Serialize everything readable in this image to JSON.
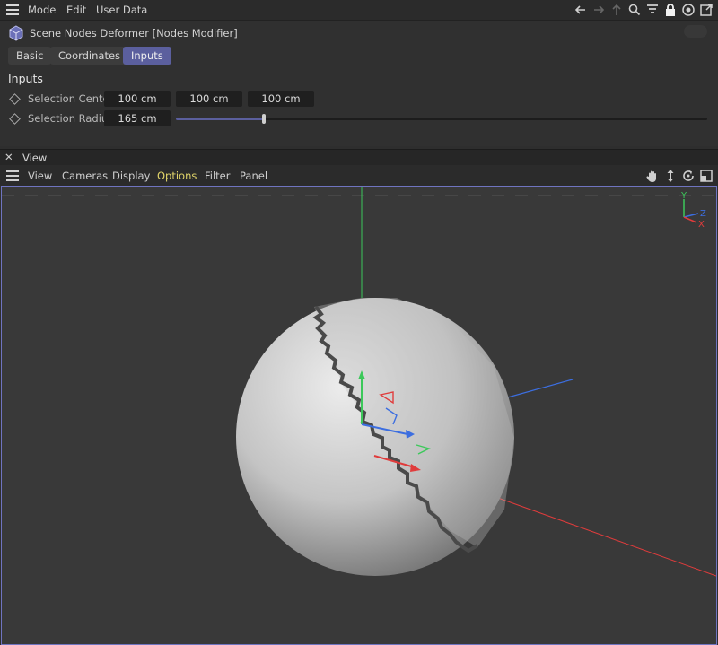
{
  "menubar": {
    "items": [
      "Mode",
      "Edit",
      "User Data"
    ],
    "icons": [
      "back-arrow-icon",
      "forward-arrow-icon",
      "up-arrow-icon",
      "search-icon",
      "filter-icon",
      "lock-icon",
      "target-icon",
      "new-window-icon"
    ]
  },
  "object": {
    "title": "Scene Nodes Deformer [Nodes Modifier]",
    "icon": "nodes-cube-icon"
  },
  "tabs": [
    {
      "label": "Basic",
      "active": false
    },
    {
      "label": "Coordinates",
      "active": false
    },
    {
      "label": "Inputs",
      "active": true
    }
  ],
  "inputs": {
    "section_title": "Inputs",
    "selection_center": {
      "label": "Selection Center",
      "x": "100 cm",
      "y": "100 cm",
      "z": "100 cm"
    },
    "selection_radius": {
      "label": "Selection Radius",
      "value": "165 cm",
      "slider_fraction": 0.165
    }
  },
  "view_panel": {
    "close": "✕",
    "title": "View",
    "menu": [
      "View",
      "Cameras",
      "Display",
      "Options",
      "Filter",
      "Panel"
    ],
    "highlighted": "Options",
    "nav_icons": [
      "move-hand-icon",
      "zoom-arrows-icon",
      "rotate-icon",
      "maximize-icon"
    ]
  },
  "axis_gizmo": {
    "y": "Y",
    "z": "Z",
    "x": "X"
  },
  "colors": {
    "accent": "#5b5f9e",
    "highlight_text": "#e3d66a",
    "x_axis": "#e03c3c",
    "y_axis": "#3cc85a",
    "z_axis": "#3c6ee0"
  }
}
